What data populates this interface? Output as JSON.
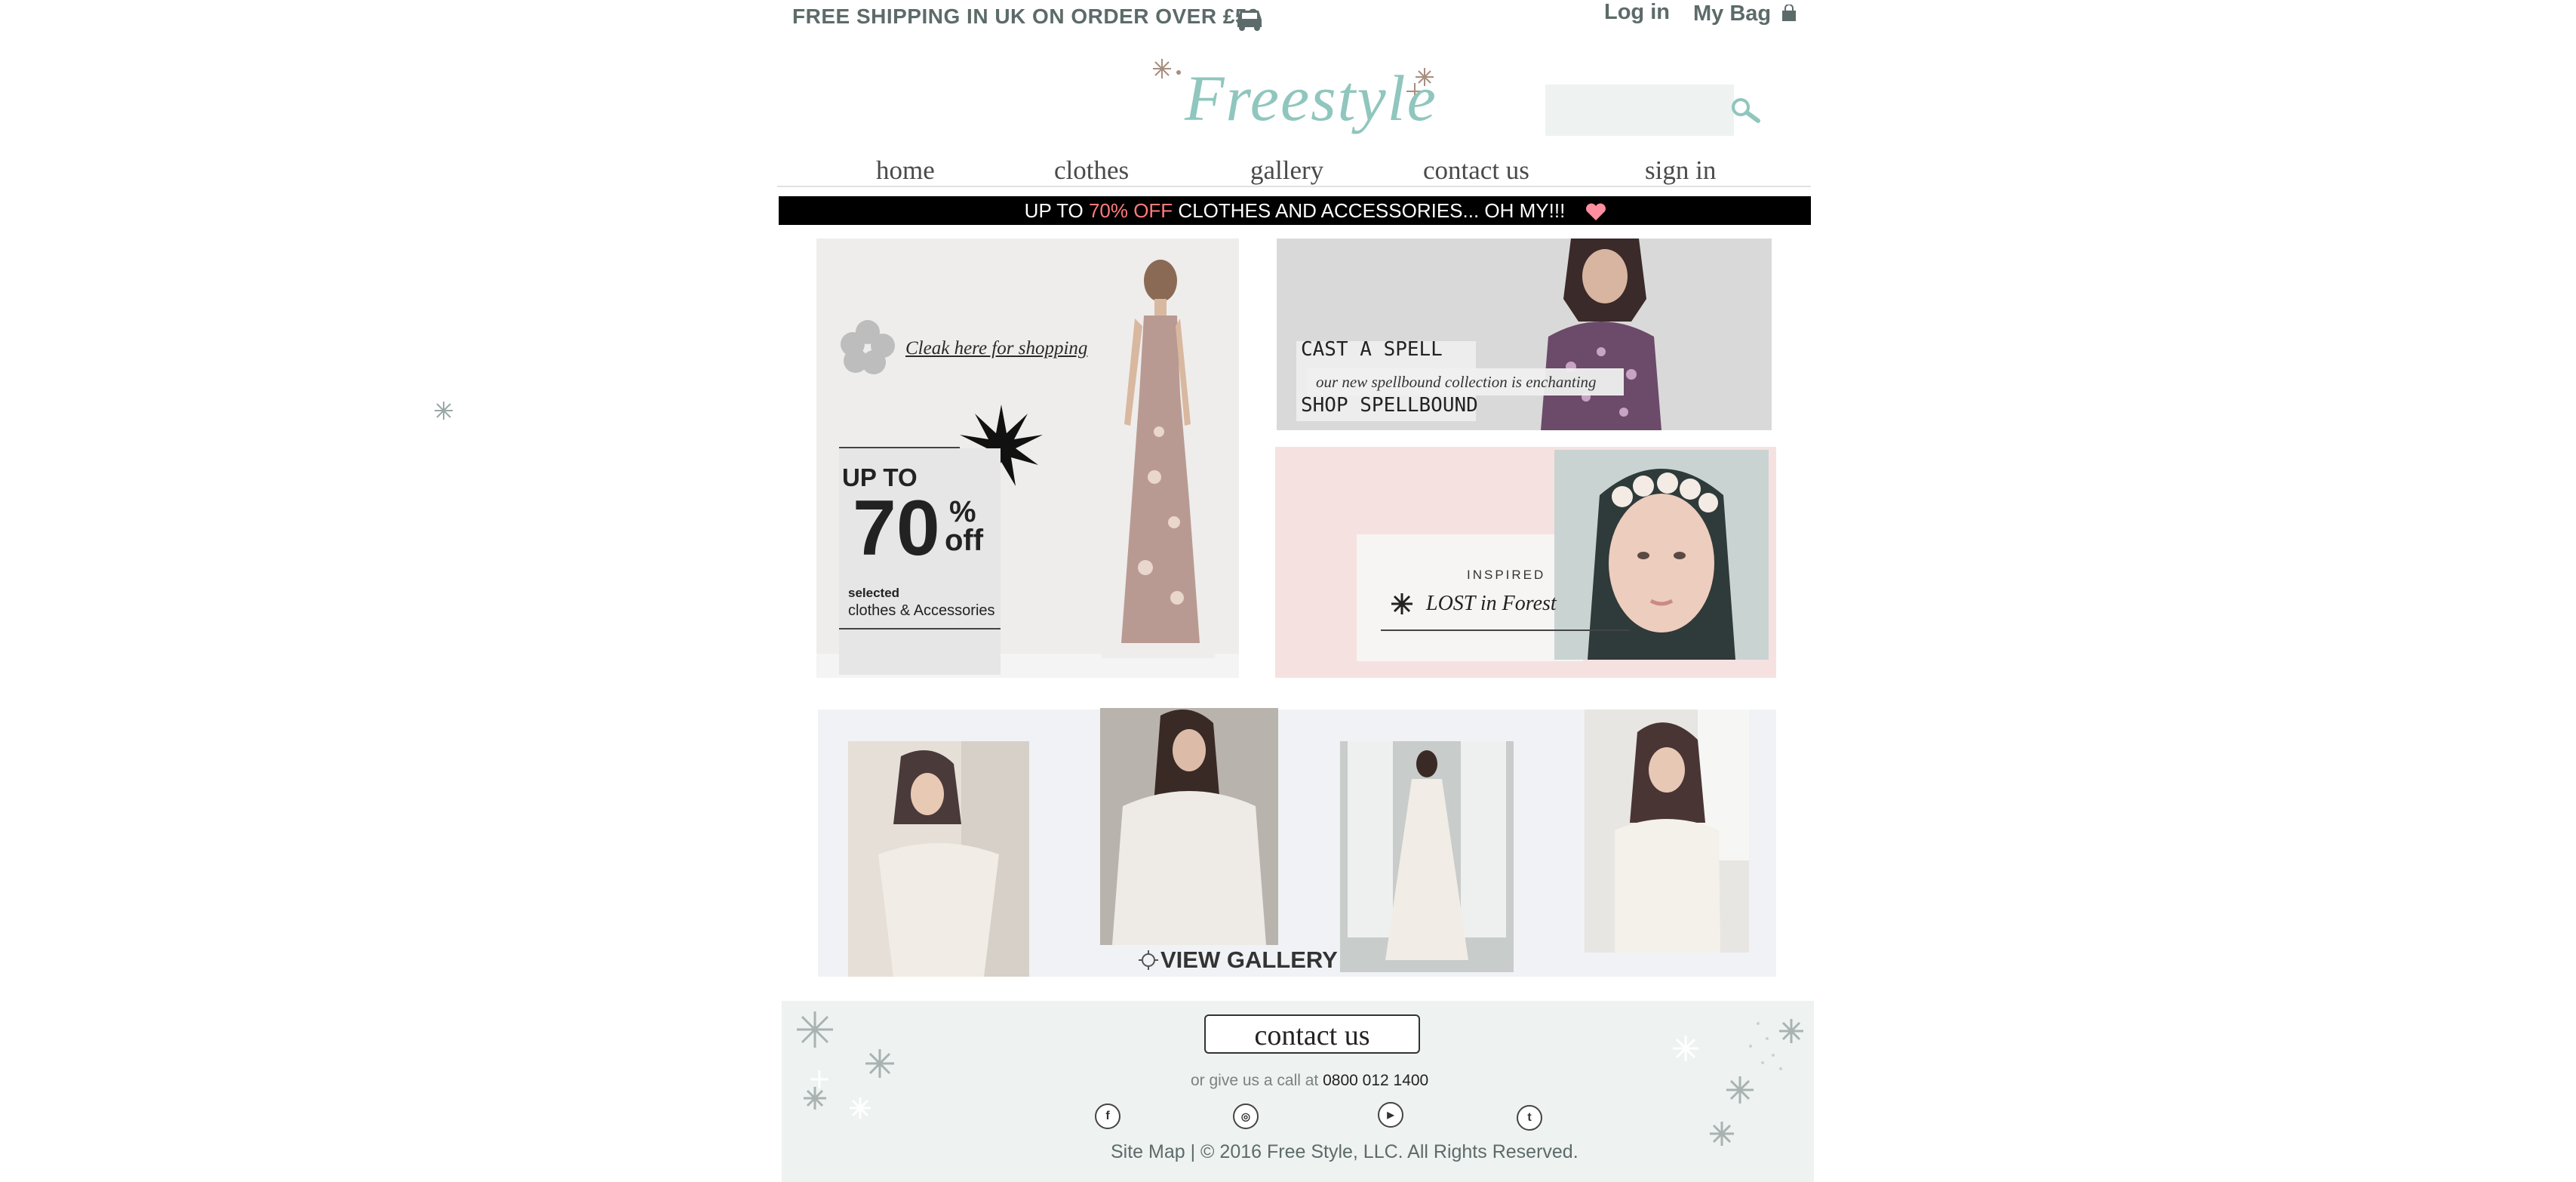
{
  "header": {
    "shipping_text": "FREE SHIPPING IN UK ON ORDER OVER £50",
    "login": "Log in",
    "my_bag": "My Bag",
    "logo": "Freestyle"
  },
  "search": {
    "placeholder": ""
  },
  "nav": {
    "items": [
      "home",
      "clothes",
      "gallery",
      "contact us",
      "sign in"
    ]
  },
  "promo_bar": {
    "prefix": "UP  TO ",
    "highlight": "70% OFF",
    "suffix": " CLOTHES AND ACCESSORIES... OH MY!!!"
  },
  "hero": {
    "shop_link": "Cleak here for shopping",
    "up_to": "UP TO",
    "percent_value": "70",
    "percent_sign": "%",
    "off": "off",
    "selected": "selected",
    "clothes_accessories": "clothes & Accessories",
    "cast_a_spell": "CAST A SPELL",
    "spell_subtitle": "our new spellbound collection is enchanting",
    "shop_spellbound": "SHOP SPELLBOUND",
    "inspired": "INSPIRED",
    "lost_in_forest": "LOST in Forest"
  },
  "gallery": {
    "view_gallery": "VIEW GALLERY"
  },
  "footer": {
    "contact_us": "contact us",
    "call_prefix": "or give us a call at ",
    "phone": "0800 012 1400",
    "copyright": "Site Map |  © 2016 Free Style, LLC. All Rights Reserved.",
    "social": [
      {
        "icon": "facebook-icon",
        "glyph": "f"
      },
      {
        "icon": "instagram-icon",
        "glyph": "◎"
      },
      {
        "icon": "youtube-icon",
        "glyph": "▶"
      },
      {
        "icon": "twitter-icon",
        "glyph": "t"
      }
    ]
  },
  "colors": {
    "accent_teal": "#8fc6bd",
    "header_text": "#5c6b69",
    "promo_highlight": "#ff7b7b",
    "pink_panel": "#f6e1e1",
    "footer_bg": "#eef2f1"
  }
}
